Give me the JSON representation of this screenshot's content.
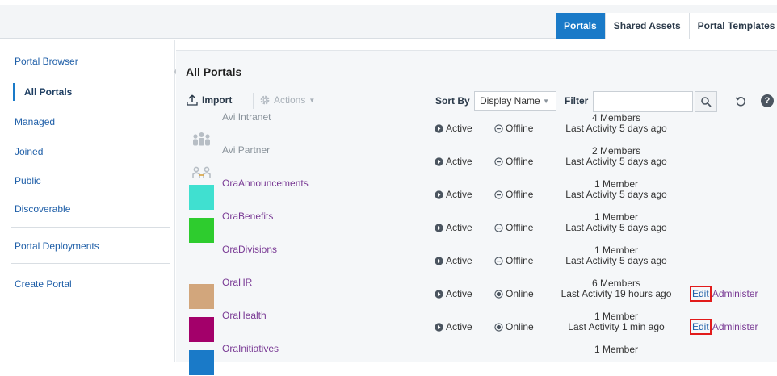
{
  "top_tabs": [
    {
      "label": "Portals",
      "active": true
    },
    {
      "label": "Shared Assets",
      "active": false
    },
    {
      "label": "Portal Templates",
      "active": false
    }
  ],
  "sidebar": {
    "items": [
      {
        "label": "Portal Browser",
        "selected": false
      },
      {
        "label": "All Portals",
        "selected": true
      },
      {
        "label": "Managed",
        "selected": false
      },
      {
        "label": "Joined",
        "selected": false
      },
      {
        "label": "Public",
        "selected": false
      },
      {
        "label": "Discoverable",
        "selected": false
      },
      {
        "label": "Portal Deployments",
        "selected": false
      },
      {
        "label": "Create Portal",
        "selected": false
      }
    ]
  },
  "main": {
    "title": "All Portals",
    "toolbar": {
      "import_label": "Import",
      "actions_label": "Actions",
      "sort_by_label": "Sort By",
      "sort_value": "Display Name",
      "filter_label": "Filter",
      "filter_value": "",
      "help_glyph": "?"
    }
  },
  "portals": [
    {
      "name": "Avi Intranet",
      "thumb": "group-people-icon",
      "thumb_color": "",
      "status": "Active",
      "state": "Offline",
      "members": "4 Members",
      "activity": "Last Activity 5 days ago",
      "actions": false
    },
    {
      "name": "Avi Partner",
      "thumb": "partner-people-icon",
      "thumb_color": "",
      "status": "Active",
      "state": "Offline",
      "members": "2 Members",
      "activity": "Last Activity 5 days ago",
      "actions": false
    },
    {
      "name": "OraAnnouncements",
      "thumb": "color-swatch",
      "thumb_color": "#40e0d0",
      "status": "Active",
      "state": "Offline",
      "members": "1 Member",
      "activity": "Last Activity 5 days ago",
      "actions": false
    },
    {
      "name": "OraBenefits",
      "thumb": "color-swatch",
      "thumb_color": "#2ecc2e",
      "status": "Active",
      "state": "Offline",
      "members": "1 Member",
      "activity": "Last Activity 5 days ago",
      "actions": false
    },
    {
      "name": "OraDivisions",
      "thumb": "none",
      "thumb_color": "",
      "status": "Active",
      "state": "Offline",
      "members": "1 Member",
      "activity": "Last Activity 5 days ago",
      "actions": false
    },
    {
      "name": "OraHR",
      "thumb": "color-swatch",
      "thumb_color": "#d2a67c",
      "status": "Active",
      "state": "Online",
      "members": "6 Members",
      "activity": "Last Activity 19 hours ago",
      "actions": true
    },
    {
      "name": "OraHealth",
      "thumb": "color-swatch",
      "thumb_color": "#a3006a",
      "status": "Active",
      "state": "Online",
      "members": "1 Member",
      "activity": "Last Activity 1 min ago",
      "actions": true
    },
    {
      "name": "OraInitiatives",
      "thumb": "color-swatch",
      "thumb_color": "#1a7ac8",
      "status": "",
      "state": "",
      "members": "1 Member",
      "activity": "",
      "actions": false
    }
  ],
  "row_actions": {
    "edit_label": "Edit",
    "separator": "|",
    "administer_label": "Administer"
  },
  "colors": {
    "accent": "#1a7ac8",
    "link": "#1f5fa8",
    "visited_link": "#7a3b95",
    "highlight": "#e21b1b"
  }
}
